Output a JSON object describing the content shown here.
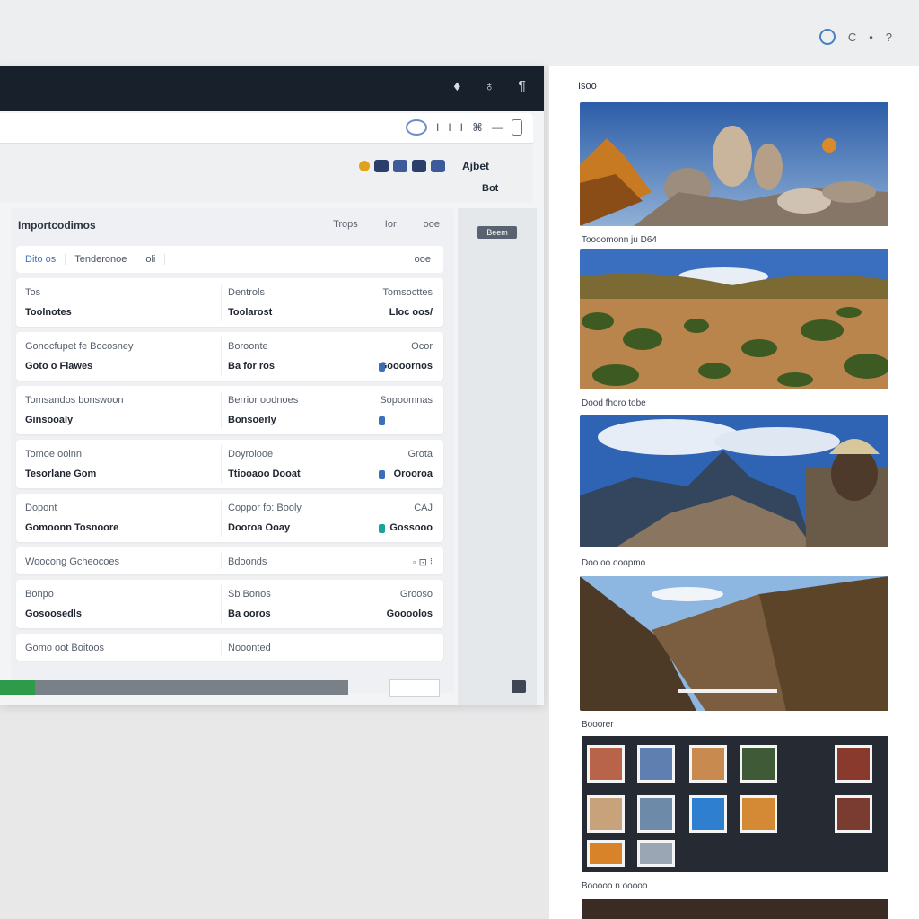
{
  "os_bar": {
    "tray": [
      "C",
      "•",
      "?"
    ]
  },
  "window": {
    "controls": [
      "♦",
      "♁",
      "¶"
    ],
    "address_bar": {
      "items": [
        "I",
        "I",
        "I",
        "⌘"
      ],
      "tail": "—"
    },
    "toolbar": {
      "label": "Ajbet",
      "sub": "Bot"
    },
    "side_chip": "Beem"
  },
  "panel": {
    "title": "Importcodimos",
    "links": [
      "Trops",
      "Ior",
      "ooe"
    ],
    "tabs": [
      "Dito os",
      "Tenderonoe",
      "oli"
    ],
    "tab_right": "ooe",
    "rows": [
      {
        "c1_top": "Tos",
        "c1_bot": "Toolnotes",
        "c2_top": "Dentrols",
        "c2_bot": "Toolarost",
        "c3_top": "Tomsocttes",
        "c3_bot": "Lloc oos/",
        "icon": false
      },
      {
        "c1_top": "Gonocfupet fe Bocosney",
        "c1_bot": "Goto o Flawes",
        "c2_top": "Boroonte",
        "c2_bot": "Ba for ros",
        "c3_top": "Ocor",
        "c3_bot": "Goooornos",
        "icon": true,
        "icon_color": "blue"
      },
      {
        "c1_top": "Tomsandos bonswoon",
        "c1_bot": "Ginsooaly",
        "c2_top": "Berrior oodnoes",
        "c2_bot": "Bonsoerly",
        "c3_top": "Sopoomnas",
        "c3_bot": "",
        "icon": true,
        "icon_color": "blue"
      },
      {
        "c1_top": "Tomoe ooinn",
        "c1_bot": "Tesorlane Gom",
        "c2_top": "Doyrolooe",
        "c2_bot": "Ttiooaoo Dooat",
        "c3_top": "Grota",
        "c3_bot": "Orooroa",
        "icon": true,
        "icon_color": "blue"
      },
      {
        "c1_top": "Dopont",
        "c1_bot": "Gomoonn Tosnoore",
        "c2_top": "Coppor fo: Booly",
        "c2_bot": "Dooroa Ooay",
        "c3_top": "CAJ",
        "c3_bot": "Gossooo",
        "icon": true,
        "icon_color": "teal"
      },
      {
        "c1_top": "Woocong Gcheocoes",
        "c1_bot": "",
        "c2_top": "Bdoonds",
        "c2_bot": "",
        "c3_top": "◦ ⊡ ⁞",
        "c3_bot": "",
        "icon": false
      },
      {
        "c1_top": "Bonpo",
        "c1_bot": "Gosoosedls",
        "c2_top": "Sb Bonos",
        "c2_bot": "Ba ooros",
        "c3_top": "Grooso",
        "c3_bot": "Goooolos",
        "icon": false
      },
      {
        "c1_top": "Gomo oot Boitoos",
        "c1_bot": "",
        "c2_top": "Nooonted",
        "c2_bot": "",
        "c3_top": "",
        "c3_bot": "",
        "icon": false
      }
    ],
    "progress_fraction": 0.1
  },
  "gallery": {
    "header": "Isoo",
    "captions": [
      "Toooomonn ju D64",
      "Dood fhoro tobe",
      "Doo oo ooopmo",
      "Booorer",
      "Booooo n ooooo"
    ]
  },
  "colors": {
    "accent": "#4a7fc2",
    "titlebar": "#18202c",
    "progress": "#2f9a49",
    "alert": "#d9382b"
  }
}
